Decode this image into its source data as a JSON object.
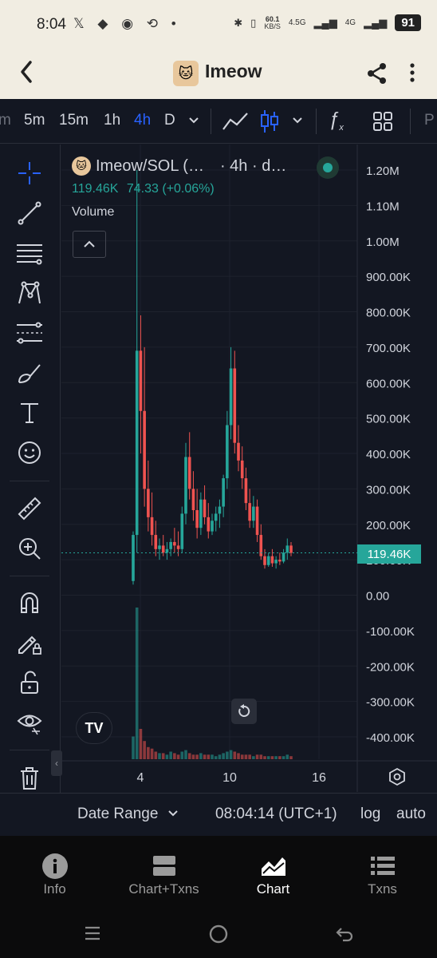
{
  "status_bar": {
    "time": "8:04",
    "left_icons": [
      "x-icon",
      "pill-icon",
      "snapchat-icon",
      "app-icon"
    ],
    "speed_value": "60.1",
    "speed_unit": "KB/S",
    "net1": "4.5G",
    "net2": "4G",
    "battery": "91"
  },
  "header": {
    "title": "Imeow",
    "logo_emoji": "🐱"
  },
  "toolbar": {
    "timeframes": [
      "m",
      "5m",
      "15m",
      "1h",
      "4h",
      "D"
    ],
    "active_timeframe": "4h",
    "accent": "#2962ff"
  },
  "legend": {
    "symbol": "Imeow/SOL (…",
    "interval": "· 4h · d…",
    "last": "119.46K",
    "change": "74.33 (+0.06%)",
    "volume_label": "Volume"
  },
  "price_tag": "119.46K",
  "chart_data": {
    "type": "candlestick",
    "y_ticks": [
      "1.20M",
      "1.10M",
      "1.00M",
      "900.00K",
      "800.00K",
      "700.00K",
      "600.00K",
      "500.00K",
      "400.00K",
      "300.00K",
      "200.00K",
      "100.00K",
      "0.00",
      "-100.00K",
      "-200.00K",
      "-300.00K",
      "-400.00K"
    ],
    "x_ticks": [
      "4",
      "10",
      "16"
    ],
    "ylim": [
      -400000,
      1200000
    ],
    "last_price": 119460,
    "up_color": "#26a69a",
    "down_color": "#ef5350",
    "candles": [
      {
        "o": 40000,
        "h": 180000,
        "l": 30000,
        "c": 170000
      },
      {
        "o": 170000,
        "h": 1200000,
        "l": 120000,
        "c": 690000
      },
      {
        "o": 690000,
        "h": 790000,
        "l": 400000,
        "c": 520000
      },
      {
        "o": 520000,
        "h": 700000,
        "l": 250000,
        "c": 300000
      },
      {
        "o": 300000,
        "h": 380000,
        "l": 180000,
        "c": 220000
      },
      {
        "o": 220000,
        "h": 290000,
        "l": 140000,
        "c": 170000
      },
      {
        "o": 170000,
        "h": 210000,
        "l": 110000,
        "c": 130000
      },
      {
        "o": 130000,
        "h": 160000,
        "l": 100000,
        "c": 140000
      },
      {
        "o": 140000,
        "h": 170000,
        "l": 110000,
        "c": 120000
      },
      {
        "o": 120000,
        "h": 150000,
        "l": 100000,
        "c": 130000
      },
      {
        "o": 130000,
        "h": 160000,
        "l": 110000,
        "c": 150000
      },
      {
        "o": 150000,
        "h": 190000,
        "l": 120000,
        "c": 140000
      },
      {
        "o": 140000,
        "h": 180000,
        "l": 110000,
        "c": 130000
      },
      {
        "o": 130000,
        "h": 250000,
        "l": 120000,
        "c": 230000
      },
      {
        "o": 230000,
        "h": 430000,
        "l": 200000,
        "c": 390000
      },
      {
        "o": 390000,
        "h": 460000,
        "l": 270000,
        "c": 300000
      },
      {
        "o": 300000,
        "h": 350000,
        "l": 210000,
        "c": 240000
      },
      {
        "o": 240000,
        "h": 300000,
        "l": 160000,
        "c": 190000
      },
      {
        "o": 190000,
        "h": 290000,
        "l": 170000,
        "c": 270000
      },
      {
        "o": 270000,
        "h": 310000,
        "l": 200000,
        "c": 220000
      },
      {
        "o": 220000,
        "h": 260000,
        "l": 160000,
        "c": 180000
      },
      {
        "o": 180000,
        "h": 230000,
        "l": 170000,
        "c": 210000
      },
      {
        "o": 210000,
        "h": 250000,
        "l": 180000,
        "c": 230000
      },
      {
        "o": 230000,
        "h": 270000,
        "l": 190000,
        "c": 250000
      },
      {
        "o": 250000,
        "h": 340000,
        "l": 220000,
        "c": 330000
      },
      {
        "o": 330000,
        "h": 520000,
        "l": 300000,
        "c": 480000
      },
      {
        "o": 480000,
        "h": 700000,
        "l": 440000,
        "c": 640000
      },
      {
        "o": 640000,
        "h": 690000,
        "l": 400000,
        "c": 430000
      },
      {
        "o": 430000,
        "h": 480000,
        "l": 350000,
        "c": 380000
      },
      {
        "o": 380000,
        "h": 420000,
        "l": 300000,
        "c": 330000
      },
      {
        "o": 330000,
        "h": 360000,
        "l": 240000,
        "c": 260000
      },
      {
        "o": 260000,
        "h": 300000,
        "l": 190000,
        "c": 210000
      },
      {
        "o": 210000,
        "h": 280000,
        "l": 190000,
        "c": 250000
      },
      {
        "o": 250000,
        "h": 270000,
        "l": 150000,
        "c": 170000
      },
      {
        "o": 170000,
        "h": 200000,
        "l": 100000,
        "c": 110000
      },
      {
        "o": 110000,
        "h": 130000,
        "l": 75000,
        "c": 85000
      },
      {
        "o": 85000,
        "h": 120000,
        "l": 80000,
        "c": 110000
      },
      {
        "o": 110000,
        "h": 130000,
        "l": 80000,
        "c": 90000
      },
      {
        "o": 90000,
        "h": 110000,
        "l": 75000,
        "c": 100000
      },
      {
        "o": 100000,
        "h": 120000,
        "l": 85000,
        "c": 95000
      },
      {
        "o": 95000,
        "h": 130000,
        "l": 90000,
        "c": 120000
      },
      {
        "o": 120000,
        "h": 160000,
        "l": 100000,
        "c": 140000
      },
      {
        "o": 140000,
        "h": 150000,
        "l": 110000,
        "c": 119460
      }
    ],
    "volumes": [
      0.15,
      1.0,
      0.2,
      0.12,
      0.08,
      0.07,
      0.05,
      0.04,
      0.04,
      0.03,
      0.05,
      0.04,
      0.03,
      0.05,
      0.06,
      0.04,
      0.03,
      0.03,
      0.04,
      0.03,
      0.03,
      0.03,
      0.02,
      0.03,
      0.04,
      0.05,
      0.06,
      0.05,
      0.04,
      0.03,
      0.03,
      0.03,
      0.02,
      0.03,
      0.03,
      0.02,
      0.02,
      0.02,
      0.02,
      0.02,
      0.02,
      0.03,
      0.02
    ]
  },
  "date_range": {
    "label": "Date Range",
    "clock": "08:04:14 (UTC+1)",
    "log": "log",
    "auto": "auto"
  },
  "bottom_nav": [
    {
      "label": "Info",
      "icon": "info-icon"
    },
    {
      "label": "Chart+Txns",
      "icon": "split-icon"
    },
    {
      "label": "Chart",
      "icon": "chart-icon",
      "active": true
    },
    {
      "label": "Txns",
      "icon": "list-icon"
    }
  ],
  "tv_logo": "TV"
}
